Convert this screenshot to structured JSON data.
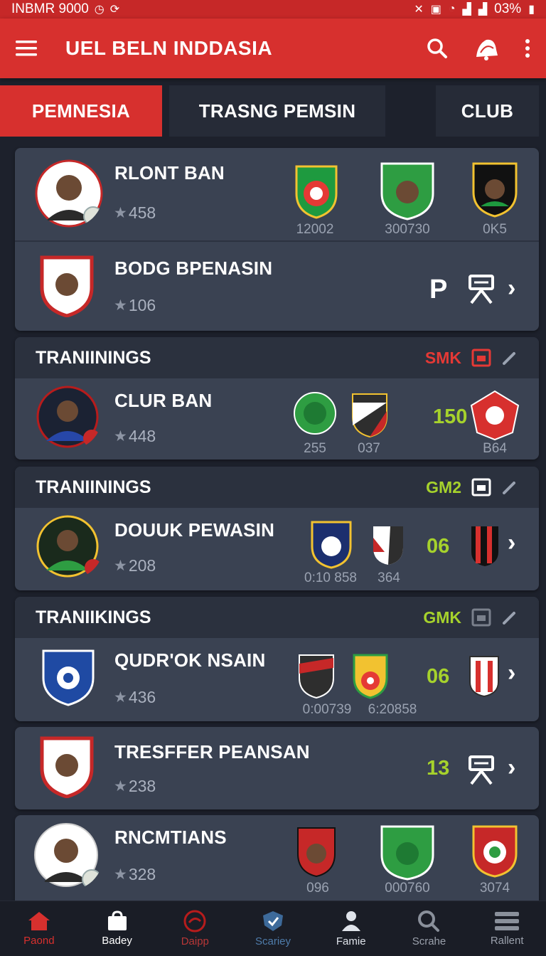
{
  "status_bar": {
    "left_text": "INBMR 9000",
    "battery": "03%"
  },
  "app_bar": {
    "title": "UEL BELN INDDASIA"
  },
  "tabs": [
    "PEMNESIA",
    "TRASNG PEMSIN",
    "CLUB"
  ],
  "groups": [
    {
      "title": "",
      "code": "",
      "code_color": "",
      "rows": [
        {
          "name": "RLONT BAN",
          "stars": "458",
          "badges": [
            {
              "value": "12002"
            },
            {
              "value": "300730"
            },
            {
              "value": "0K5"
            }
          ]
        },
        {
          "name": "BODG BPENASIN",
          "stars": "106",
          "score": "P"
        }
      ]
    },
    {
      "title": "TRANIININGS",
      "code": "SMK",
      "code_color": "#e53935",
      "rows": [
        {
          "name": "CLUR BAN",
          "stars": "448",
          "score": "150",
          "badges": [
            {
              "value": "255"
            },
            {
              "value": "037"
            },
            {
              "value": "B64"
            }
          ]
        }
      ]
    },
    {
      "title": "TRANIININGS",
      "code": "GM2",
      "code_color": "#a6d22c",
      "rows": [
        {
          "name": "DOUUK PEWASIN",
          "stars": "208",
          "score": "06",
          "badges": [
            {
              "value": "0:10 858"
            },
            {
              "value": "364"
            }
          ]
        }
      ]
    },
    {
      "title": "TRANIIKINGS",
      "code": "GMK",
      "code_color": "#a6d22c",
      "rows": [
        {
          "name": "QUDR'OK NSAIN",
          "stars": "436",
          "score": "06",
          "badges": [
            {
              "value": "0:00739"
            },
            {
              "value": "6:20858"
            }
          ]
        }
      ]
    },
    {
      "title": "",
      "code": "",
      "code_color": "",
      "rows": [
        {
          "name": "TRESFFER PEANSAN",
          "stars": "238",
          "score": "13"
        }
      ]
    },
    {
      "title": "",
      "code": "",
      "code_color": "",
      "rows": [
        {
          "name": "RNCMTIANS",
          "stars": "328",
          "badges": [
            {
              "value": "096"
            },
            {
              "value": "000760"
            },
            {
              "value": "3074"
            }
          ]
        }
      ]
    }
  ],
  "bottom_nav": [
    {
      "label": "Paond",
      "icon": "home-icon",
      "active": true
    },
    {
      "label": "Badey",
      "icon": "bag-icon"
    },
    {
      "label": "Daipp",
      "icon": "target-icon"
    },
    {
      "label": "Scariey",
      "icon": "shield-icon"
    },
    {
      "label": "Famie",
      "icon": "person-icon"
    },
    {
      "label": "Scrahe",
      "icon": "search-icon"
    },
    {
      "label": "Rallent",
      "icon": "menu-icon"
    }
  ],
  "colors": {
    "accent": "#d7302e",
    "score": "#a6d22c",
    "panel": "#3a4252",
    "background": "#1d212c"
  }
}
